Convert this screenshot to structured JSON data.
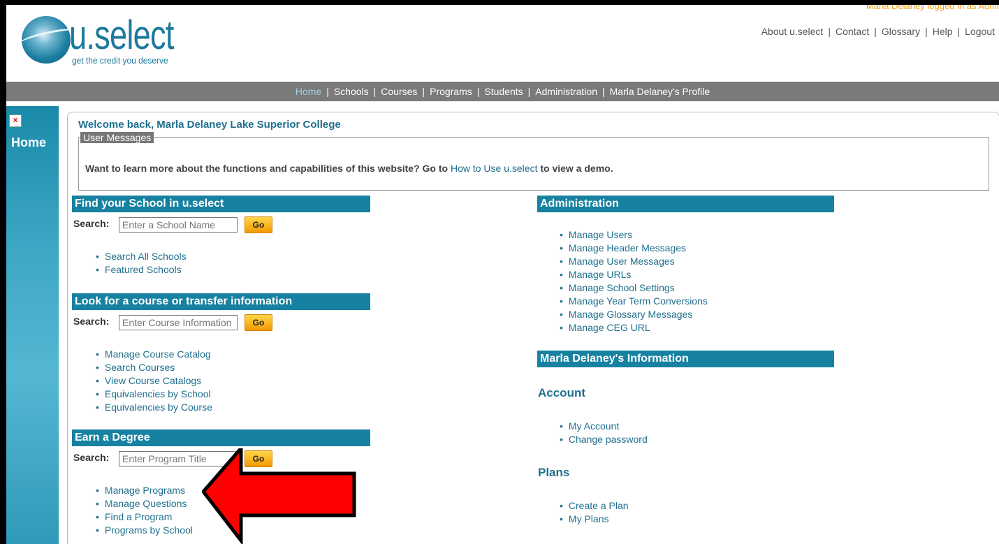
{
  "header": {
    "logo_text": "u.select",
    "tagline": "get the credit you deserve",
    "login_note": "Marla Delaney logged in as Admi",
    "links": [
      "About u.select",
      "Contact",
      "Glossary",
      "Help",
      "Logout"
    ]
  },
  "nav": {
    "items": [
      "Home",
      "Schools",
      "Courses",
      "Programs",
      "Students",
      "Administration",
      "Marla Delaney's Profile"
    ]
  },
  "rail": {
    "title": "Home",
    "close_glyph": "×"
  },
  "welcome": "Welcome back, Marla Delaney  Lake Superior College",
  "user_messages": {
    "legend": "User Messages",
    "text_before": "Want to learn more about the functions and capabilities of this website? Go to ",
    "link": "How to Use u.select",
    "text_after": " to view a demo."
  },
  "find_school": {
    "title": "Find your School in u.select",
    "search_label": "Search:",
    "placeholder": "Enter a School Name",
    "go": "Go",
    "links": [
      "Search All Schools",
      "Featured Schools"
    ]
  },
  "course": {
    "title": "Look for a course or transfer information",
    "search_label": "Search:",
    "placeholder": "Enter Course Information",
    "go": "Go",
    "links": [
      "Manage Course Catalog",
      "Search Courses",
      "View Course Catalogs",
      "Equivalencies by School",
      "Equivalencies by Course"
    ]
  },
  "degree": {
    "title": "Earn a Degree",
    "search_label": "Search:",
    "placeholder": "Enter Program Title",
    "go": "Go",
    "links": [
      "Manage Programs",
      "Manage Questions",
      "Find a Program",
      "Programs by School"
    ]
  },
  "administration": {
    "title": "Administration",
    "links": [
      "Manage Users",
      "Manage Header Messages",
      "Manage User Messages",
      "Manage URLs",
      "Manage School Settings",
      "Manage Year Term Conversions",
      "Manage Glossary Messages",
      "Manage CEG URL"
    ]
  },
  "info": {
    "title": "Marla Delaney's Information",
    "account_title": "Account",
    "account_links": [
      "My Account",
      "Change password"
    ],
    "plans_title": "Plans",
    "plans_links": [
      "Create a Plan",
      "My Plans"
    ]
  },
  "colors": {
    "teal": "#1681a0",
    "nav_gray": "#7a7a7a",
    "arrow_red": "#ff0000",
    "go_orange": "#f39a00"
  }
}
